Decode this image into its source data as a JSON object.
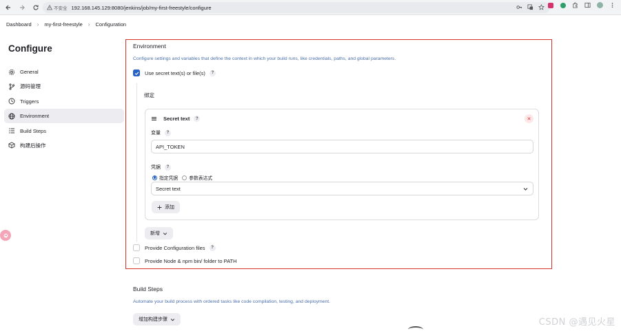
{
  "browser": {
    "insecure_label": "不安全",
    "url": "192.168.145.129:8080/jenkins/job/my-first-freestyle/configure"
  },
  "breadcrumb": [
    "Dashboard",
    "my-first-freestyle",
    "Configuration"
  ],
  "page_title": "Configure",
  "sidebar": {
    "items": [
      {
        "label": "General",
        "icon": "gear-icon"
      },
      {
        "label": "源码管理",
        "icon": "branch-icon"
      },
      {
        "label": "Triggers",
        "icon": "clock-icon"
      },
      {
        "label": "Environment",
        "icon": "globe-icon",
        "active": true
      },
      {
        "label": "Build Steps",
        "icon": "list-icon"
      },
      {
        "label": "构建后操作",
        "icon": "package-icon"
      }
    ]
  },
  "environment": {
    "title": "Environment",
    "description": "Configure settings and variables that define the context in which your build runs, like credentials, paths, and global parameters.",
    "use_secret_label": "Use secret text(s) or file(s)",
    "binding_label": "绑定",
    "card": {
      "title": "Secret text",
      "variable_label": "变量",
      "variable_value": "API_TOKEN",
      "credentials_label": "凭据",
      "radio_specific": "指定凭据",
      "radio_expression": "参数表达式",
      "select_value": "Secret text",
      "add_label": "添加"
    },
    "new_label": "新增",
    "provide_config_label": "Provide Configuration files",
    "provide_node_label": "Provide Node & npm bin/ folder to PATH"
  },
  "build_steps": {
    "title": "Build Steps",
    "description": "Automate your build process with ordered tasks like code compilation, testing, and deployment.",
    "add_step_label": "增加构建步骤"
  },
  "watermark": "CSDN @遇见火星",
  "colors": {
    "accent": "#2762c6",
    "highlight_frame": "#d93025",
    "description_text": "#4a6ea9"
  }
}
